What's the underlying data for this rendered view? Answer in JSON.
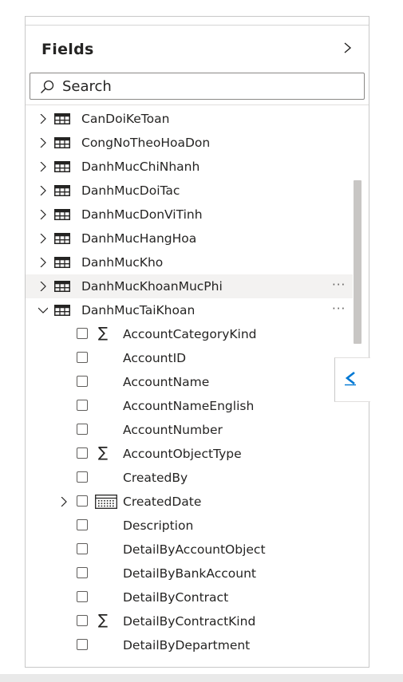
{
  "panel": {
    "title": "Fields",
    "collapse_icon": "chevron-right-icon",
    "accent_color": "#0078d4"
  },
  "search": {
    "placeholder": "Search",
    "value": "",
    "icon": "search-icon"
  },
  "tables": [
    {
      "name": "CanDoiKeToan",
      "expanded": false
    },
    {
      "name": "CongNoTheoHoaDon",
      "expanded": false
    },
    {
      "name": "DanhMucChiNhanh",
      "expanded": false
    },
    {
      "name": "DanhMucDoiTac",
      "expanded": false
    },
    {
      "name": "DanhMucDonViTinh",
      "expanded": false
    },
    {
      "name": "DanhMucHangHoa",
      "expanded": false
    },
    {
      "name": "DanhMucKho",
      "expanded": false
    },
    {
      "name": "DanhMucKhoanMucPhi",
      "expanded": false,
      "more": "···"
    },
    {
      "name": "DanhMucTaiKhoan",
      "expanded": true,
      "more": "···"
    }
  ],
  "fields": [
    {
      "name": "AccountCategoryKind",
      "type": "sigma",
      "checked": false
    },
    {
      "name": "AccountID",
      "type": "text",
      "checked": false
    },
    {
      "name": "AccountName",
      "type": "text",
      "checked": false
    },
    {
      "name": "AccountNameEnglish",
      "type": "text",
      "checked": false
    },
    {
      "name": "AccountNumber",
      "type": "text",
      "checked": false
    },
    {
      "name": "AccountObjectType",
      "type": "sigma",
      "checked": false
    },
    {
      "name": "CreatedBy",
      "type": "text",
      "checked": false
    },
    {
      "name": "CreatedDate",
      "type": "date-hierarchy",
      "checked": false
    },
    {
      "name": "Description",
      "type": "text",
      "checked": false
    },
    {
      "name": "DetailByAccountObject",
      "type": "text",
      "checked": false
    },
    {
      "name": "DetailByBankAccount",
      "type": "text",
      "checked": false
    },
    {
      "name": "DetailByContract",
      "type": "text",
      "checked": false
    },
    {
      "name": "DetailByContractKind",
      "type": "sigma",
      "checked": false
    },
    {
      "name": "DetailByDepartment",
      "type": "text",
      "checked": false
    }
  ],
  "sigma_symbol": "∑",
  "side_tab": {
    "icon": "double-chevron-left-icon",
    "color": "#0078d4"
  }
}
